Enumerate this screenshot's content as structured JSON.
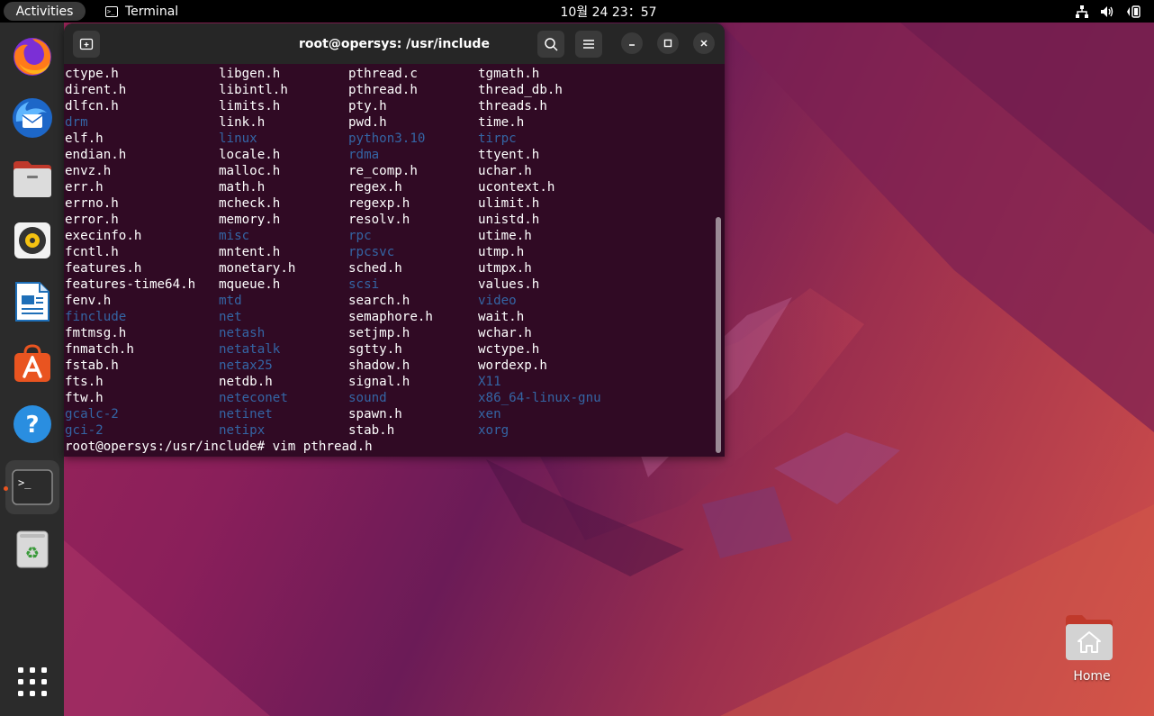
{
  "topbar": {
    "activities_label": "Activities",
    "app_name": "Terminal",
    "clock": "10월 24  23：57",
    "tray_icons": [
      "network-icon",
      "volume-icon",
      "power-icon"
    ]
  },
  "dock": {
    "items": [
      {
        "name": "firefox-icon",
        "running": false
      },
      {
        "name": "thunderbird-icon",
        "running": false
      },
      {
        "name": "files-icon",
        "running": false
      },
      {
        "name": "rhythmbox-icon",
        "running": false
      },
      {
        "name": "libreoffice-writer-icon",
        "running": false
      },
      {
        "name": "app-center-icon",
        "running": false
      },
      {
        "name": "help-icon",
        "running": false
      },
      {
        "name": "terminal-icon",
        "running": true
      },
      {
        "name": "trash-icon",
        "running": false
      },
      {
        "name": "show-apps-icon",
        "running": false
      }
    ]
  },
  "terminal": {
    "title": "root@opersys: /usr/include",
    "colors": {
      "background": "#300a24",
      "text": "#ffffff",
      "directory": "#3465a4"
    },
    "rows": [
      [
        "ctype.h",
        "libgen.h",
        "pthread.c",
        "tgmath.h"
      ],
      [
        "dirent.h",
        "libintl.h",
        "pthread.h",
        "thread_db.h"
      ],
      [
        "dlfcn.h",
        "limits.h",
        "pty.h",
        "threads.h"
      ],
      [
        "drm",
        "link.h",
        "pwd.h",
        "time.h"
      ],
      [
        "elf.h",
        "linux",
        "python3.10",
        "tirpc"
      ],
      [
        "endian.h",
        "locale.h",
        "rdma",
        "ttyent.h"
      ],
      [
        "envz.h",
        "malloc.h",
        "re_comp.h",
        "uchar.h"
      ],
      [
        "err.h",
        "math.h",
        "regex.h",
        "ucontext.h"
      ],
      [
        "errno.h",
        "mcheck.h",
        "regexp.h",
        "ulimit.h"
      ],
      [
        "error.h",
        "memory.h",
        "resolv.h",
        "unistd.h"
      ],
      [
        "execinfo.h",
        "misc",
        "rpc",
        "utime.h"
      ],
      [
        "fcntl.h",
        "mntent.h",
        "rpcsvc",
        "utmp.h"
      ],
      [
        "features.h",
        "monetary.h",
        "sched.h",
        "utmpx.h"
      ],
      [
        "features-time64.h",
        "mqueue.h",
        "scsi",
        "values.h"
      ],
      [
        "fenv.h",
        "mtd",
        "search.h",
        "video"
      ],
      [
        "finclude",
        "net",
        "semaphore.h",
        "wait.h"
      ],
      [
        "fmtmsg.h",
        "netash",
        "setjmp.h",
        "wchar.h"
      ],
      [
        "fnmatch.h",
        "netatalk",
        "sgtty.h",
        "wctype.h"
      ],
      [
        "fstab.h",
        "netax25",
        "shadow.h",
        "wordexp.h"
      ],
      [
        "fts.h",
        "netdb.h",
        "signal.h",
        "X11"
      ],
      [
        "ftw.h",
        "neteconet",
        "sound",
        "x86_64-linux-gnu"
      ],
      [
        "gcalc-2",
        "netinet",
        "spawn.h",
        "xen"
      ],
      [
        "gci-2",
        "netipx",
        "stab.h",
        "xorg"
      ]
    ],
    "directories": [
      "drm",
      "linux",
      "python3.10",
      "tirpc",
      "rdma",
      "misc",
      "rpc",
      "rpcsvc",
      "scsi",
      "mtd",
      "video",
      "finclude",
      "net",
      "netash",
      "netatalk",
      "netax25",
      "X11",
      "neteconet",
      "sound",
      "x86_64-linux-gnu",
      "gcalc-2",
      "netinet",
      "xen",
      "gci-2",
      "netipx",
      "xorg"
    ],
    "prompt": "root@opersys:/usr/include# ",
    "command": "vim pthread.h"
  },
  "desktop": {
    "home_label": "Home"
  }
}
